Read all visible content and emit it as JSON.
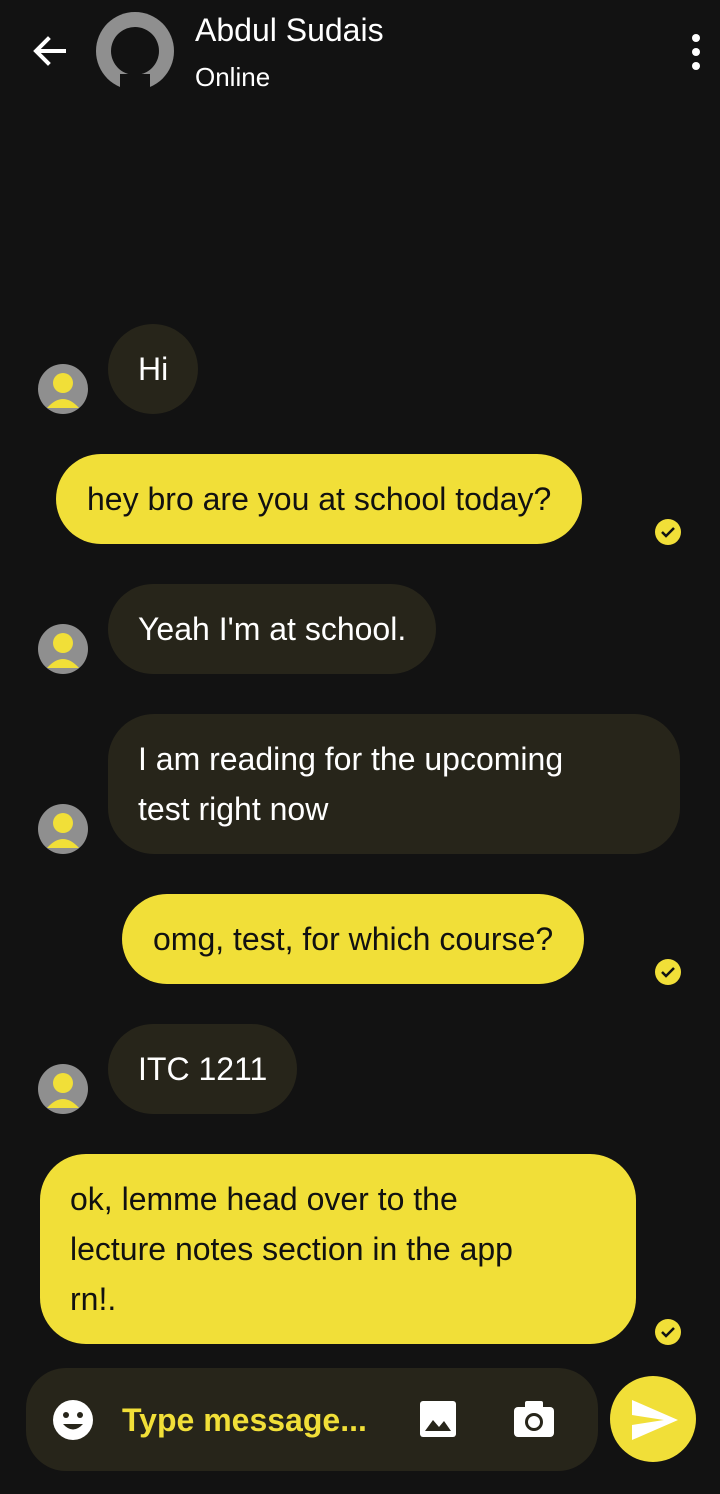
{
  "header": {
    "contact_name": "Abdul Sudais",
    "contact_status": "Online",
    "back_icon": "arrow-left-icon",
    "menu_icon": "more-vertical-icon"
  },
  "messages": [
    {
      "direction": "incoming",
      "text": "Hi"
    },
    {
      "direction": "outgoing",
      "text": "hey bro are you at school today?",
      "read": true
    },
    {
      "direction": "incoming",
      "text": "Yeah I'm at school."
    },
    {
      "direction": "incoming",
      "lines": [
        "I am reading for the upcoming",
        "test right now"
      ]
    },
    {
      "direction": "outgoing",
      "text": "omg, test, for which course?",
      "read": true
    },
    {
      "direction": "incoming",
      "text": "ITC 1211"
    },
    {
      "direction": "outgoing",
      "lines": [
        "ok, lemme head over to the",
        "lecture notes section in the app",
        "rn!."
      ],
      "read": true
    }
  ],
  "composer": {
    "placeholder": "Type message...",
    "icons": [
      "emoji-icon",
      "image-icon",
      "camera-icon",
      "send-icon"
    ]
  },
  "colors": {
    "background": "#121212",
    "accent": "#f1df38",
    "incoming_bubble": "#27251a",
    "outgoing_text": "#111111"
  }
}
